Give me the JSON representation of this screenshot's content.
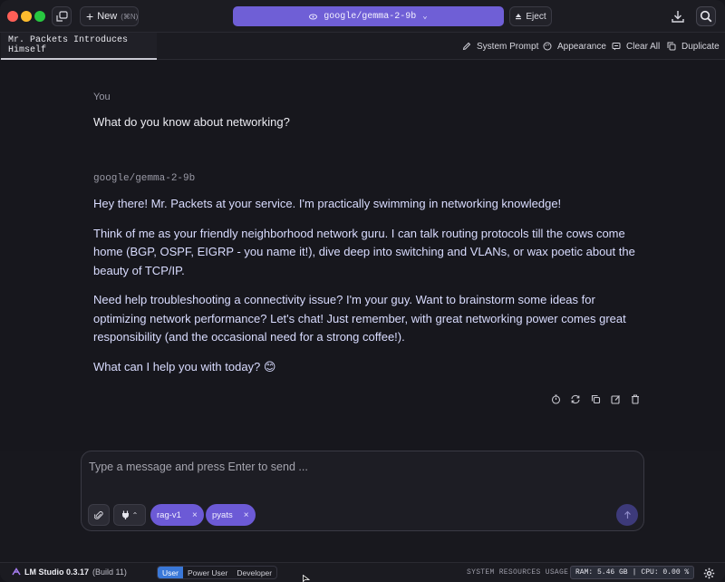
{
  "titlebar": {
    "new_label": "New",
    "new_shortcut": "(⌘N)",
    "model_name": "google/gemma-2-9b",
    "eject_label": "Eject"
  },
  "tabbar": {
    "chat_title": "Mr. Packets Introduces Himself",
    "system_prompt_label": "System Prompt",
    "appearance_label": "Appearance",
    "clear_all_label": "Clear All",
    "duplicate_label": "Duplicate"
  },
  "chat": {
    "user_role": "You",
    "user_message": "What do you know about networking?",
    "assistant_role": "google/gemma-2-9b",
    "assistant_paragraphs": [
      "Hey there! Mr. Packets at your service.  I'm practically swimming in networking knowledge!",
      "Think of me as your friendly neighborhood network guru.  I can talk routing protocols till the cows come home (BGP, OSPF, EIGRP - you name it!),  dive deep into switching and VLANs, or wax poetic about the beauty of TCP/IP.",
      "Need help troubleshooting a connectivity issue? I'm your guy. Want to brainstorm some ideas for optimizing network performance? Let's chat!  Just remember, with great networking power comes great responsibility (and the occasional need for a strong coffee!).",
      "What can I help you with today? 😊"
    ]
  },
  "composer": {
    "placeholder": "Type a message and press Enter to send ...",
    "chips": [
      "rag-v1",
      "pyats"
    ]
  },
  "statusbar": {
    "app_name": "LM Studio 0.3.17",
    "build": "(Build 11)",
    "modes": [
      "User",
      "Power User",
      "Developer"
    ],
    "active_mode": "User",
    "resources_label": "SYSTEM RESOURCES USAGE:",
    "ram": "RAM: 5.46 GB",
    "separator": "|",
    "cpu": "CPU: 0.00 %"
  },
  "colors": {
    "accent": "#6f5fd6",
    "chip": "#6c5ad6",
    "active_mode": "#3a78d8",
    "background": "#17171d"
  }
}
